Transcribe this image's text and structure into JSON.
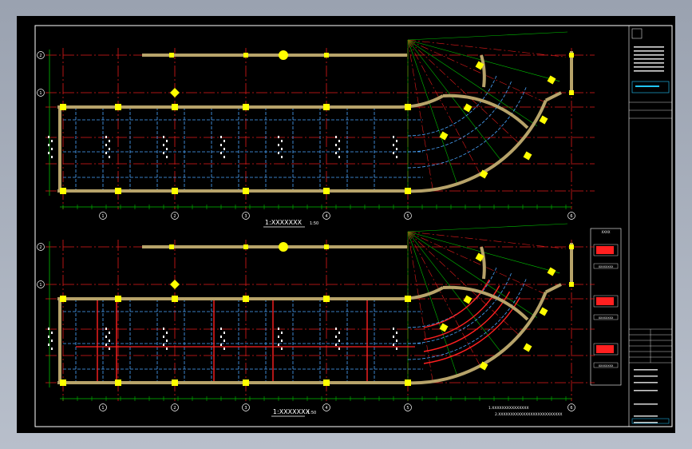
{
  "viewer": {
    "background": "#000000",
    "frame_color": "#a9b0bd"
  },
  "plans": [
    {
      "title": "1:XXXXXXX",
      "scale": "1:50"
    },
    {
      "title": "1:XXXXXXX",
      "scale": "1:50"
    }
  ],
  "grid_bubbles": {
    "rows": [
      "2",
      "1"
    ],
    "columns": [
      "1",
      "2",
      "3",
      "4",
      "5",
      "6"
    ]
  },
  "legend": {
    "header": "XXXX",
    "items": [
      "XXXXXXXX",
      "XXXXXXXX",
      "XXXXXXXX"
    ]
  },
  "notes": [
    "1.XXXXXXXXXXXXXXX",
    "2.XXXXXXXXXXXXXXXXXXXXXXXXXX"
  ],
  "colors": {
    "wall": "#b7a36a",
    "column": "#ffff00",
    "axis": "#e21b1b",
    "dimension": "#00c000",
    "beam": "#4aa6ff",
    "rebar": "#ff2020",
    "text": "#ffffff"
  }
}
